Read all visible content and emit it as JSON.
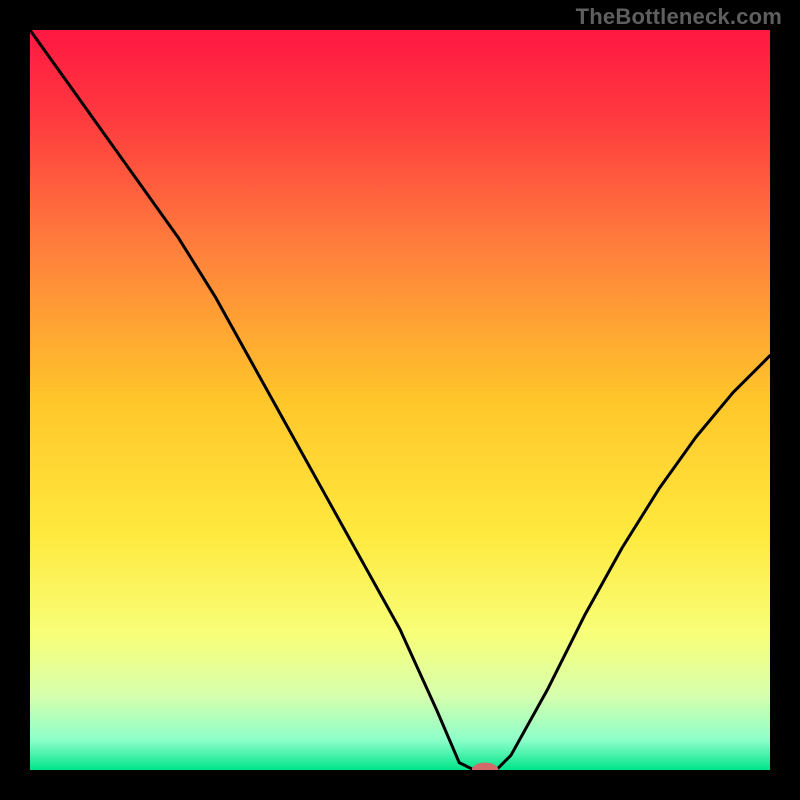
{
  "watermark": "TheBottleneck.com",
  "chart_data": {
    "type": "line",
    "title": "",
    "xlabel": "",
    "ylabel": "",
    "xlim": [
      0,
      1
    ],
    "ylim": [
      0,
      1
    ],
    "x": [
      0.0,
      0.05,
      0.1,
      0.15,
      0.2,
      0.25,
      0.3,
      0.35,
      0.4,
      0.45,
      0.5,
      0.55,
      0.58,
      0.6,
      0.63,
      0.65,
      0.7,
      0.75,
      0.8,
      0.85,
      0.9,
      0.95,
      1.0
    ],
    "values": [
      1.0,
      0.93,
      0.86,
      0.79,
      0.72,
      0.64,
      0.55,
      0.46,
      0.37,
      0.28,
      0.19,
      0.08,
      0.01,
      0.0,
      0.0,
      0.02,
      0.11,
      0.21,
      0.3,
      0.38,
      0.45,
      0.51,
      0.56
    ],
    "marker": {
      "x": 0.615,
      "y": 0.0,
      "color": "#d36a6a",
      "rx": 0.018,
      "ry": 0.01
    },
    "gradient_stops": [
      {
        "offset": 0.0,
        "color": "#ff1842"
      },
      {
        "offset": 0.12,
        "color": "#ff3a3f"
      },
      {
        "offset": 0.3,
        "color": "#ff813c"
      },
      {
        "offset": 0.5,
        "color": "#ffc62a"
      },
      {
        "offset": 0.68,
        "color": "#ffe93e"
      },
      {
        "offset": 0.82,
        "color": "#f7ff7a"
      },
      {
        "offset": 0.9,
        "color": "#d6ffae"
      },
      {
        "offset": 0.96,
        "color": "#8cffc9"
      },
      {
        "offset": 1.0,
        "color": "#00e48a"
      }
    ],
    "curve_color": "#000000",
    "curve_width": 3
  }
}
